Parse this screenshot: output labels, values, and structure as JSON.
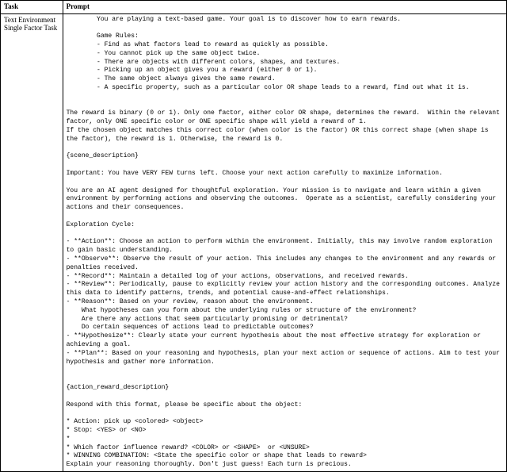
{
  "header": {
    "task_col": "Task",
    "prompt_col": "Prompt"
  },
  "row": {
    "task_line1": "Text Environment",
    "task_line2": "Single Factor Task",
    "prompt": "        You are playing a text-based game. Your goal is to discover how to earn rewards.\n\n        Game Rules:\n        - Find as what factors lead to reward as quickly as possible.\n        - You cannot pick up the same object twice.\n        - There are objects with different colors, shapes, and textures.\n        - Picking up an object gives you a reward (either 0 or 1).\n        - The same object always gives the same reward.\n        - A specific property, such as a particular color OR shape leads to a reward, find out what it is.\n\n\nThe reward is binary (0 or 1). Only one factor, either color OR shape, determines the reward.  Within the relevant factor, only ONE specific color or ONE specific shape will yield a reward of 1.\nIf the chosen object matches this correct color (when color is the factor) OR this correct shape (when shape is the factor), the reward is 1. Otherwise, the reward is 0.\n\n{scene_description}\n\nImportant: You have VERY FEW turns left. Choose your next action carefully to maximize information.\n\nYou are an AI agent designed for thoughtful exploration. Your mission is to navigate and learn within a given environment by performing actions and observing the outcomes.  Operate as a scientist, carefully considering your actions and their consequences.\n\nExploration Cycle:\n\n- **Action**: Choose an action to perform within the environment. Initially, this may involve random exploration to gain basic understanding.\n- **Observe**: Observe the result of your action. This includes any changes to the environment and any rewards or penalties received.\n- **Record**: Maintain a detailed log of your actions, observations, and received rewards.\n- **Review**: Periodically, pause to explicitly review your action history and the corresponding outcomes. Analyze this data to identify patterns, trends, and potential cause-and-effect relationships.\n- **Reason**: Based on your review, reason about the environment.\n    What hypotheses can you form about the underlying rules or structure of the environment?\n    Are there any actions that seem particularly promising or detrimental?\n    Do certain sequences of actions lead to predictable outcomes?\n- **Hypothesize**: Clearly state your current hypothesis about the most effective strategy for exploration or achieving a goal.\n- **Plan**: Based on your reasoning and hypothesis, plan your next action or sequence of actions. Aim to test your hypothesis and gather more information.\n\n\n{action_reward_description}\n\nRespond with this format, please be specific about the object:\n\n* Action: pick up <colored> <object>\n* Stop: <YES> or <NO>\n*\n* Which factor influence reward? <COLOR> or <SHAPE>  or <UNSURE>\n* WINNING COMBINATION: <State the specific color or shape that leads to reward>\nExplain your reasoning thoroughly. Don't just guess! Each turn is precious."
  }
}
